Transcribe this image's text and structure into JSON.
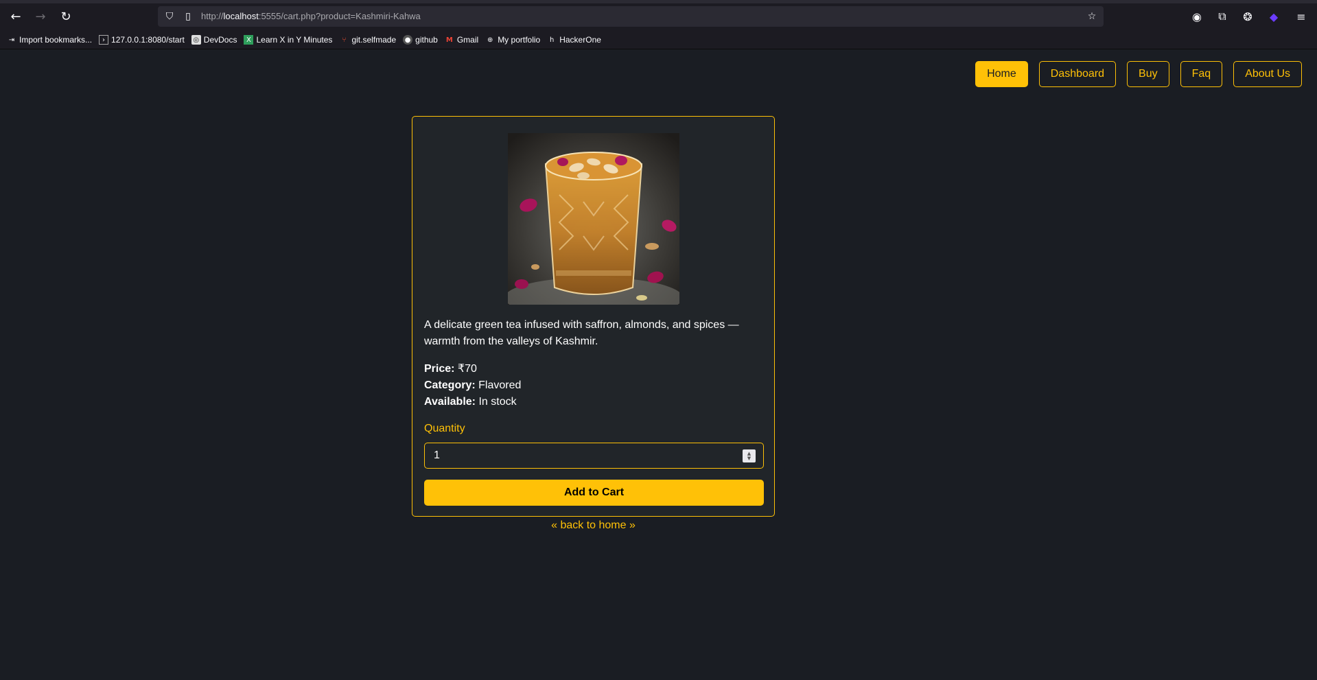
{
  "browser": {
    "url_prefix": "http://",
    "url_host": "localhost",
    "url_rest": ":5555/cart.php?product=Kashmiri-Kahwa",
    "bookmarks": [
      {
        "label": "Import bookmarks...",
        "icon": "import-icon"
      },
      {
        "label": "127.0.0.1:8080/start",
        "icon": "terminal-icon"
      },
      {
        "label": "DevDocs",
        "icon": "devdocs-icon"
      },
      {
        "label": "Learn X in Y Minutes",
        "icon": "learnx-icon"
      },
      {
        "label": "git.selfmade",
        "icon": "git-icon"
      },
      {
        "label": "github",
        "icon": "github-icon"
      },
      {
        "label": "Gmail",
        "icon": "gmail-icon"
      },
      {
        "label": "My portfolio",
        "icon": "globe-icon"
      },
      {
        "label": "HackerOne",
        "icon": "hackerone-icon"
      }
    ]
  },
  "nav": {
    "home": "Home",
    "dashboard": "Dashboard",
    "buy": "Buy",
    "faq": "Faq",
    "about": "About Us"
  },
  "product": {
    "description": "A delicate green tea infused with saffron, almonds, and spices — warmth from the valleys of Kashmir.",
    "price_label": "Price:",
    "price_value": "₹70",
    "category_label": "Category:",
    "category_value": "Flavored",
    "available_label": "Available:",
    "available_value": "In stock",
    "quantity_label": "Quantity",
    "quantity_value": "1",
    "add_button": "Add to Cart",
    "back_link": "« back to home »"
  },
  "colors": {
    "accent": "#ffc107",
    "background": "#1a1d23",
    "card": "#212529"
  }
}
